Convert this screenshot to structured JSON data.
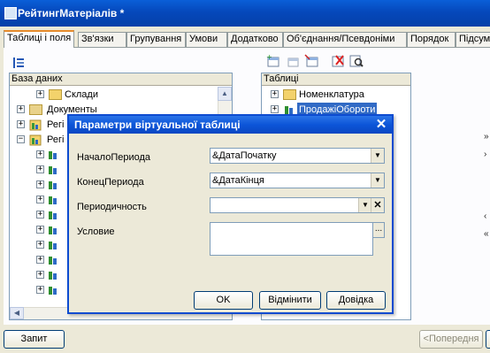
{
  "window": {
    "title": "РейтингМатеріалів *"
  },
  "tabs": [
    {
      "label": "Таблиці і поля"
    },
    {
      "label": "Зв'язки"
    },
    {
      "label": "Групування"
    },
    {
      "label": "Умови"
    },
    {
      "label": "Додатково"
    },
    {
      "label": "Об'єднання/Псевдоніми"
    },
    {
      "label": "Порядок"
    },
    {
      "label": "Підсум"
    }
  ],
  "left_panel": {
    "header": "База даних",
    "items": [
      {
        "label": "Склади"
      },
      {
        "label": "Документы"
      },
      {
        "label": "Регі"
      },
      {
        "label": "Регі"
      }
    ]
  },
  "right_panel": {
    "header": "Таблиці",
    "items": [
      {
        "label": "Номенклатура"
      },
      {
        "label": "ПродажіОбороти"
      }
    ]
  },
  "dialog": {
    "title": "Параметри віртуальної таблиці",
    "fields": [
      {
        "label": "НачалоПериода",
        "value": "&ДатаПочатку"
      },
      {
        "label": "КонецПериода",
        "value": "&ДатаКінця"
      },
      {
        "label": "Периодичность",
        "value": ""
      },
      {
        "label": "Условие",
        "value": ""
      }
    ],
    "buttons": {
      "ok": "OK",
      "cancel": "Відмінити",
      "help": "Довідка"
    }
  },
  "bottom": {
    "query_button": "Запит",
    "prev_button": "<Попередня"
  },
  "colors": {
    "title_bar": "#0548bb",
    "selection": "#316ac5",
    "tab_accent": "#e68b2c"
  }
}
